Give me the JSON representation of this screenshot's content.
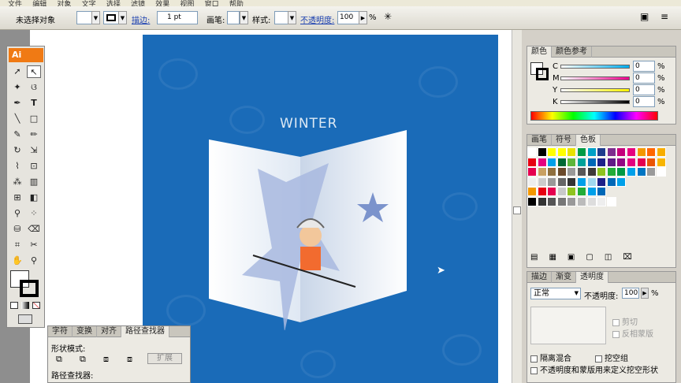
{
  "menubar": {
    "items": [
      "文件",
      "编辑",
      "对象",
      "文字",
      "选择",
      "滤镜",
      "效果",
      "视图",
      "窗口",
      "帮助"
    ]
  },
  "control": {
    "selection": "未选择对象",
    "stroke_label": "描边:",
    "stroke_value": "1 pt",
    "brush_label": "画笔:",
    "style_label": "样式:",
    "opacity_label": "不透明度:",
    "opacity_value": "100",
    "opacity_unit": "%"
  },
  "card": {
    "title": "WINTER"
  },
  "toolbox": {
    "logo": "Ai"
  },
  "color_panel": {
    "tabs": [
      "颜色",
      "颜色参考"
    ],
    "channels": [
      {
        "name": "C",
        "value": "0",
        "unit": "%"
      },
      {
        "name": "M",
        "value": "0",
        "unit": "%"
      },
      {
        "name": "Y",
        "value": "0",
        "unit": "%"
      },
      {
        "name": "K",
        "value": "0",
        "unit": "%"
      }
    ]
  },
  "swatch_panel": {
    "tabs": [
      "画笔",
      "符号",
      "色板"
    ]
  },
  "transparency_panel": {
    "tabs": [
      "描边",
      "渐变",
      "透明度"
    ],
    "blend_mode": "正常",
    "opacity_label": "不透明度:",
    "opacity_value": "100",
    "opacity_unit": "%",
    "clip": "剪切",
    "invert_mask": "反相蒙版",
    "isolate": "隔离混合",
    "knockout": "挖空组",
    "mask_defines": "不透明度和蒙版用来定义挖空形状"
  },
  "pathfinder": {
    "tabs": [
      "字符",
      "变换",
      "对齐",
      "路径查找器"
    ],
    "shape_modes": "形状模式:",
    "expand": "扩展",
    "pathfinders": "路径查找器:"
  },
  "colors": {
    "artboard": "#1a6bb8",
    "accent": "#f07a14"
  }
}
